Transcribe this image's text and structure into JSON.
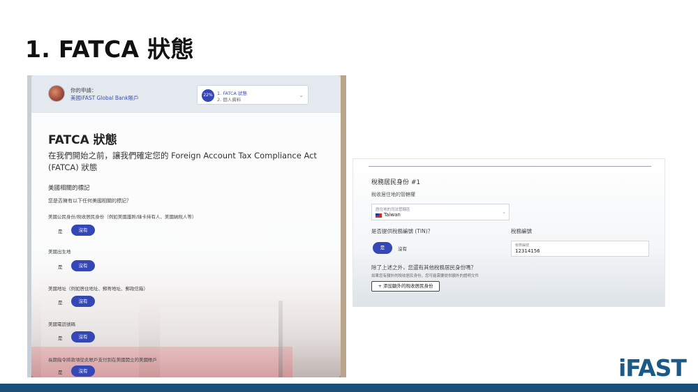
{
  "slide": {
    "title": "1. FATCA 狀態",
    "logo": "iFAST"
  },
  "left_screen": {
    "header": {
      "application_label": "你的申請：",
      "application_name": "美國iFAST Global Bank賬戶",
      "progress_percent": "22%",
      "progress_value": 0.22,
      "step1": "1. FATCA 狀態",
      "step2": "2. 個人資料"
    },
    "heading": "FATCA 狀態",
    "lead": "在我們開始之前，讓我們確定您的 Foreign Account Tax Compliance Act (FATCA) 狀態",
    "section_title": "美國相關的標記",
    "section_question": "您是否擁有以下任何美國相關的標記？",
    "questions": [
      {
        "label": "美國公民身份/稅收居民身份（例如美國護照/綠卡持有人、美國納稅人等）",
        "yes": "是",
        "no": "沒有",
        "selected": "no"
      },
      {
        "label": "美國出生地",
        "yes": "是",
        "no": "沒有",
        "selected": "no"
      },
      {
        "label": "美國地址（例如居住地址、郵寄地址、郵政信箱）",
        "yes": "是",
        "no": "沒有",
        "selected": "no"
      },
      {
        "label": "美國電話號碼",
        "yes": "是",
        "no": "沒有",
        "selected": "no"
      },
      {
        "label": "長期指令將款項從此賬戶支付到在美國開立的美國賬戶",
        "yes": "是",
        "no": "沒有",
        "selected": "no"
      }
    ]
  },
  "right_screen": {
    "title": "稅務居民身份 #1",
    "jurisdiction_label": "稅收居住地的管轄權",
    "select_small_label": "居住地的司法管轄區",
    "select_value": "Taiwan",
    "tin_question": "是否提供稅務編號 (TIN)？",
    "tin_label": "稅務編號",
    "yes": "是",
    "no": "沒有",
    "tin_selected": "yes",
    "tin_small_label": "稅務編號",
    "tin_value": "12314156",
    "other_question": "除了上述之外，您還有其他稅務居民身份嗎？",
    "other_note": "如果您有額外的稅收居民身份，您可能需要提供額外的證明文件",
    "add_button": "+ 添加額外的稅收居民身份"
  }
}
